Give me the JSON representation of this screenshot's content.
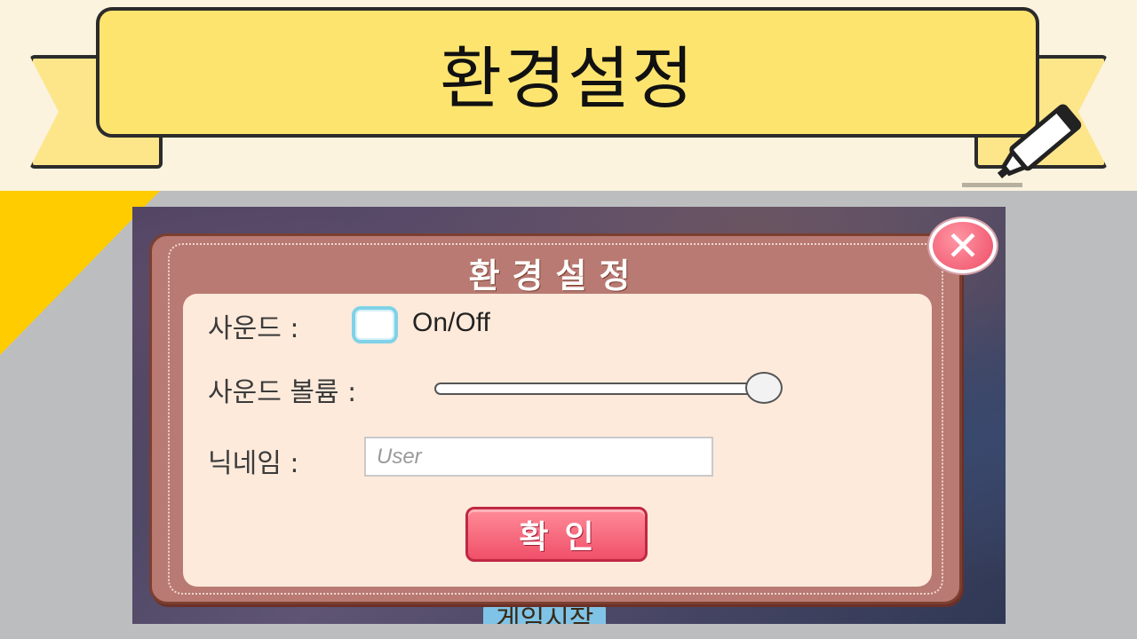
{
  "banner": {
    "title": "환경설정",
    "icon": "marker-pen-icon"
  },
  "background": {
    "start_label": "게임시작"
  },
  "dialog": {
    "title": "환경설정",
    "close_icon": "close-icon",
    "sound": {
      "label": "사운드 :",
      "toggle_text": "On/Off",
      "checked": false
    },
    "volume": {
      "label": "사운드 볼륨 :",
      "value": 1.0
    },
    "nickname": {
      "label": "닉네임 :",
      "placeholder": "User",
      "value": ""
    },
    "confirm_label": "확인"
  },
  "colors": {
    "banner_fill": "#fde46f",
    "dialog_frame": "#b87a72",
    "dialog_inner": "#feeadb",
    "confirm_button": "#f0506a",
    "checkbox_border": "#7fd2e7",
    "accent_yellow": "#ffcc00"
  }
}
